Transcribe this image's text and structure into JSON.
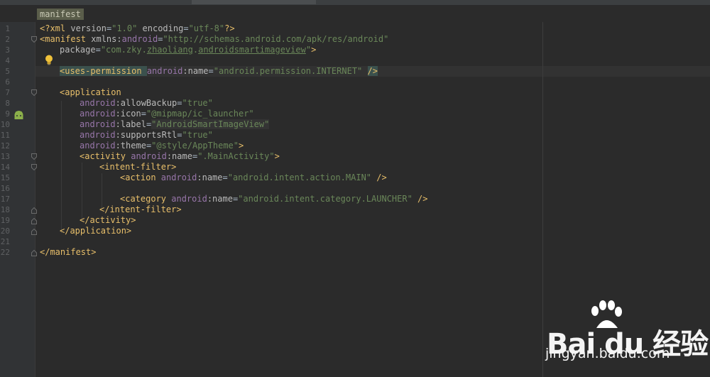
{
  "editor": {
    "breadcrumb": "manifest",
    "line_numbers": [
      "1",
      "2",
      "3",
      "4",
      "5",
      "6",
      "7",
      "8",
      "9",
      "10",
      "11",
      "12",
      "13",
      "14",
      "15",
      "16",
      "17",
      "18",
      "19",
      "20",
      "21",
      "22"
    ]
  },
  "code": {
    "l1": {
      "open": "<?xml ",
      "k1": "version",
      "e1": "=",
      "v1": "\"1.0\"",
      "k2": " encoding",
      "e2": "=",
      "v2": "\"utf-8\"",
      "close": "?>"
    },
    "l2": {
      "tag": "<manifest ",
      "attr": "xmlns:",
      "ns": "android",
      "eq": "=",
      "val": "\"http://schemas.android.com/apk/res/android\""
    },
    "l3": {
      "attr": "package",
      "eq": "=",
      "q1": "\"com.zky.",
      "u1": "zhaoliang",
      "dot": ".",
      "u2": "androidsmartimageview",
      "q2": "\"",
      "close": ">"
    },
    "l5": {
      "tag": "<uses-permission ",
      "ns": "android",
      "attr": ":name",
      "eq": "=",
      "val": "\"android.permission.INTERNET\"",
      "close": "/>"
    },
    "l7": {
      "tag": "<application"
    },
    "l8": {
      "ns": "android",
      "attr": ":allowBackup",
      "eq": "=",
      "val": "\"true\""
    },
    "l9": {
      "ns": "android",
      "attr": ":icon",
      "eq": "=",
      "val": "\"@mipmap/ic_launcher\""
    },
    "l10": {
      "ns": "android",
      "attr": ":label",
      "eq": "=",
      "val": "\"AndroidSmartImageView\""
    },
    "l11": {
      "ns": "android",
      "attr": ":supportsRtl",
      "eq": "=",
      "val": "\"true\""
    },
    "l12": {
      "ns": "android",
      "attr": ":theme",
      "eq": "=",
      "val": "\"@style/AppTheme\"",
      "close": ">"
    },
    "l13": {
      "tag": "<activity ",
      "ns": "android",
      "attr": ":name",
      "eq": "=",
      "val": "\".MainActivity\"",
      "close": ">"
    },
    "l14": {
      "tag": "<intent-filter>"
    },
    "l15": {
      "tag": "<action ",
      "ns": "android",
      "attr": ":name",
      "eq": "=",
      "val": "\"android.intent.action.MAIN\"",
      "close": " />"
    },
    "l17": {
      "tag": "<category ",
      "ns": "android",
      "attr": ":name",
      "eq": "=",
      "val": "\"android.intent.category.LAUNCHER\"",
      "close": " />"
    },
    "l18": {
      "tag": "</intent-filter>"
    },
    "l19": {
      "tag": "</activity>"
    },
    "l20": {
      "tag": "</application>"
    },
    "l22": {
      "tag": "</manifest>"
    }
  },
  "watermark": {
    "logo": "Bai du 经验",
    "url": "jingyan.baidu.com"
  },
  "colors": {
    "tag": "#e8bf6a",
    "namespace": "#9876aa",
    "value": "#6a8759",
    "text": "#a9b7c6",
    "background": "#2b2b2b",
    "gutter": "#313335"
  },
  "icons": [
    "intention-bulb-icon",
    "android-robot-icon",
    "fold-marker-icon"
  ]
}
